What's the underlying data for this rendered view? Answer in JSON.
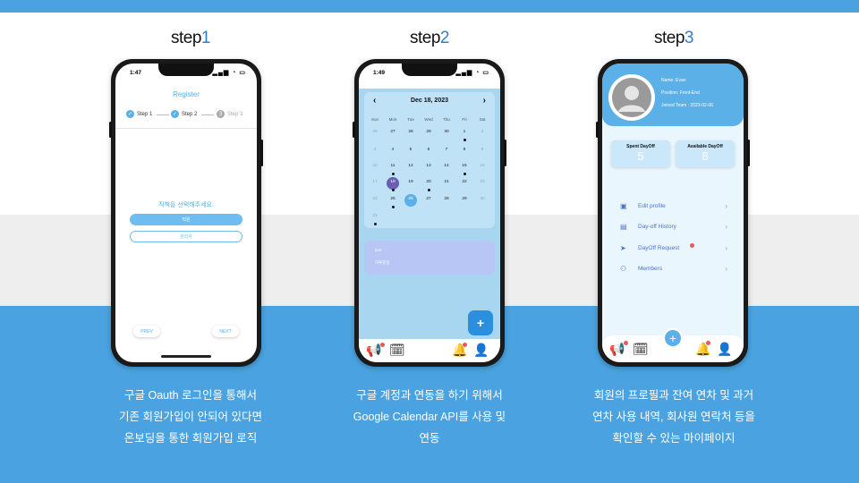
{
  "steps": [
    {
      "prefix": "step",
      "num": "1",
      "caption": [
        "구글 Oauth 로그인을 통해서",
        "기존 회원가입이 안되어 있다면",
        "온보딩을 통한 회원가입 로직"
      ]
    },
    {
      "prefix": "step",
      "num": "2",
      "caption": [
        "구글 계정과 연동을 하기 위해서",
        "Google Calendar API를 사용 및",
        "연동"
      ]
    },
    {
      "prefix": "step",
      "num": "3",
      "caption": [
        "회원의 프로필과 잔여 연차 및 과거",
        "연차 사용 내역, 회사원 연락처 등을",
        "확인할 수 있는 마이페이지"
      ]
    }
  ],
  "phone1": {
    "time": "1:47",
    "title": "Register",
    "step_labels": [
      "Step 1",
      "Step 2",
      "Step 3"
    ],
    "step_numbers": [
      "✓",
      "✓",
      "3"
    ],
    "question": "직책을 선택해주세요.",
    "option1": "직원",
    "option2": "관리자",
    "prev": "PREV",
    "next": "NEXT"
  },
  "phone2": {
    "time": "1:49",
    "month": "Dec 18, 2023",
    "weekdays": [
      "Sun",
      "Mon",
      "Tue",
      "Wed",
      "Thu",
      "Fri",
      "Sat"
    ],
    "weeks": [
      [
        "26",
        "27",
        "28",
        "29",
        "30",
        "1",
        "2"
      ],
      [
        "3",
        "4",
        "5",
        "6",
        "7",
        "8",
        "9"
      ],
      [
        "10",
        "11",
        "12",
        "13",
        "14",
        "15",
        "16"
      ],
      [
        "17",
        "18",
        "19",
        "20",
        "21",
        "22",
        "23"
      ],
      [
        "24",
        "25",
        "26",
        "27",
        "28",
        "29",
        "30"
      ],
      [
        "31",
        "",
        "",
        "",
        "",
        "",
        ""
      ]
    ],
    "event_title": "test",
    "event_sub": "하루종일",
    "fab": "+"
  },
  "phone3": {
    "name": "Name: Evan",
    "position": "Position: Front-End",
    "joined": "Joined Team : 2023-02-06",
    "spent_label": "Spent DayOff",
    "spent_value": "5",
    "avail_label": "Available DayOff",
    "avail_value": "8",
    "menu": [
      "Edit profile",
      "Day-off History",
      "DayOff Request",
      "Members"
    ],
    "fab": "+"
  },
  "colors": {
    "accent": "#4aa3e0",
    "light_blue": "#5bb0e8",
    "calendar_bg": "#bfe2f6",
    "selected_day": "#6a5fb3",
    "today": "#5bb0e8"
  }
}
